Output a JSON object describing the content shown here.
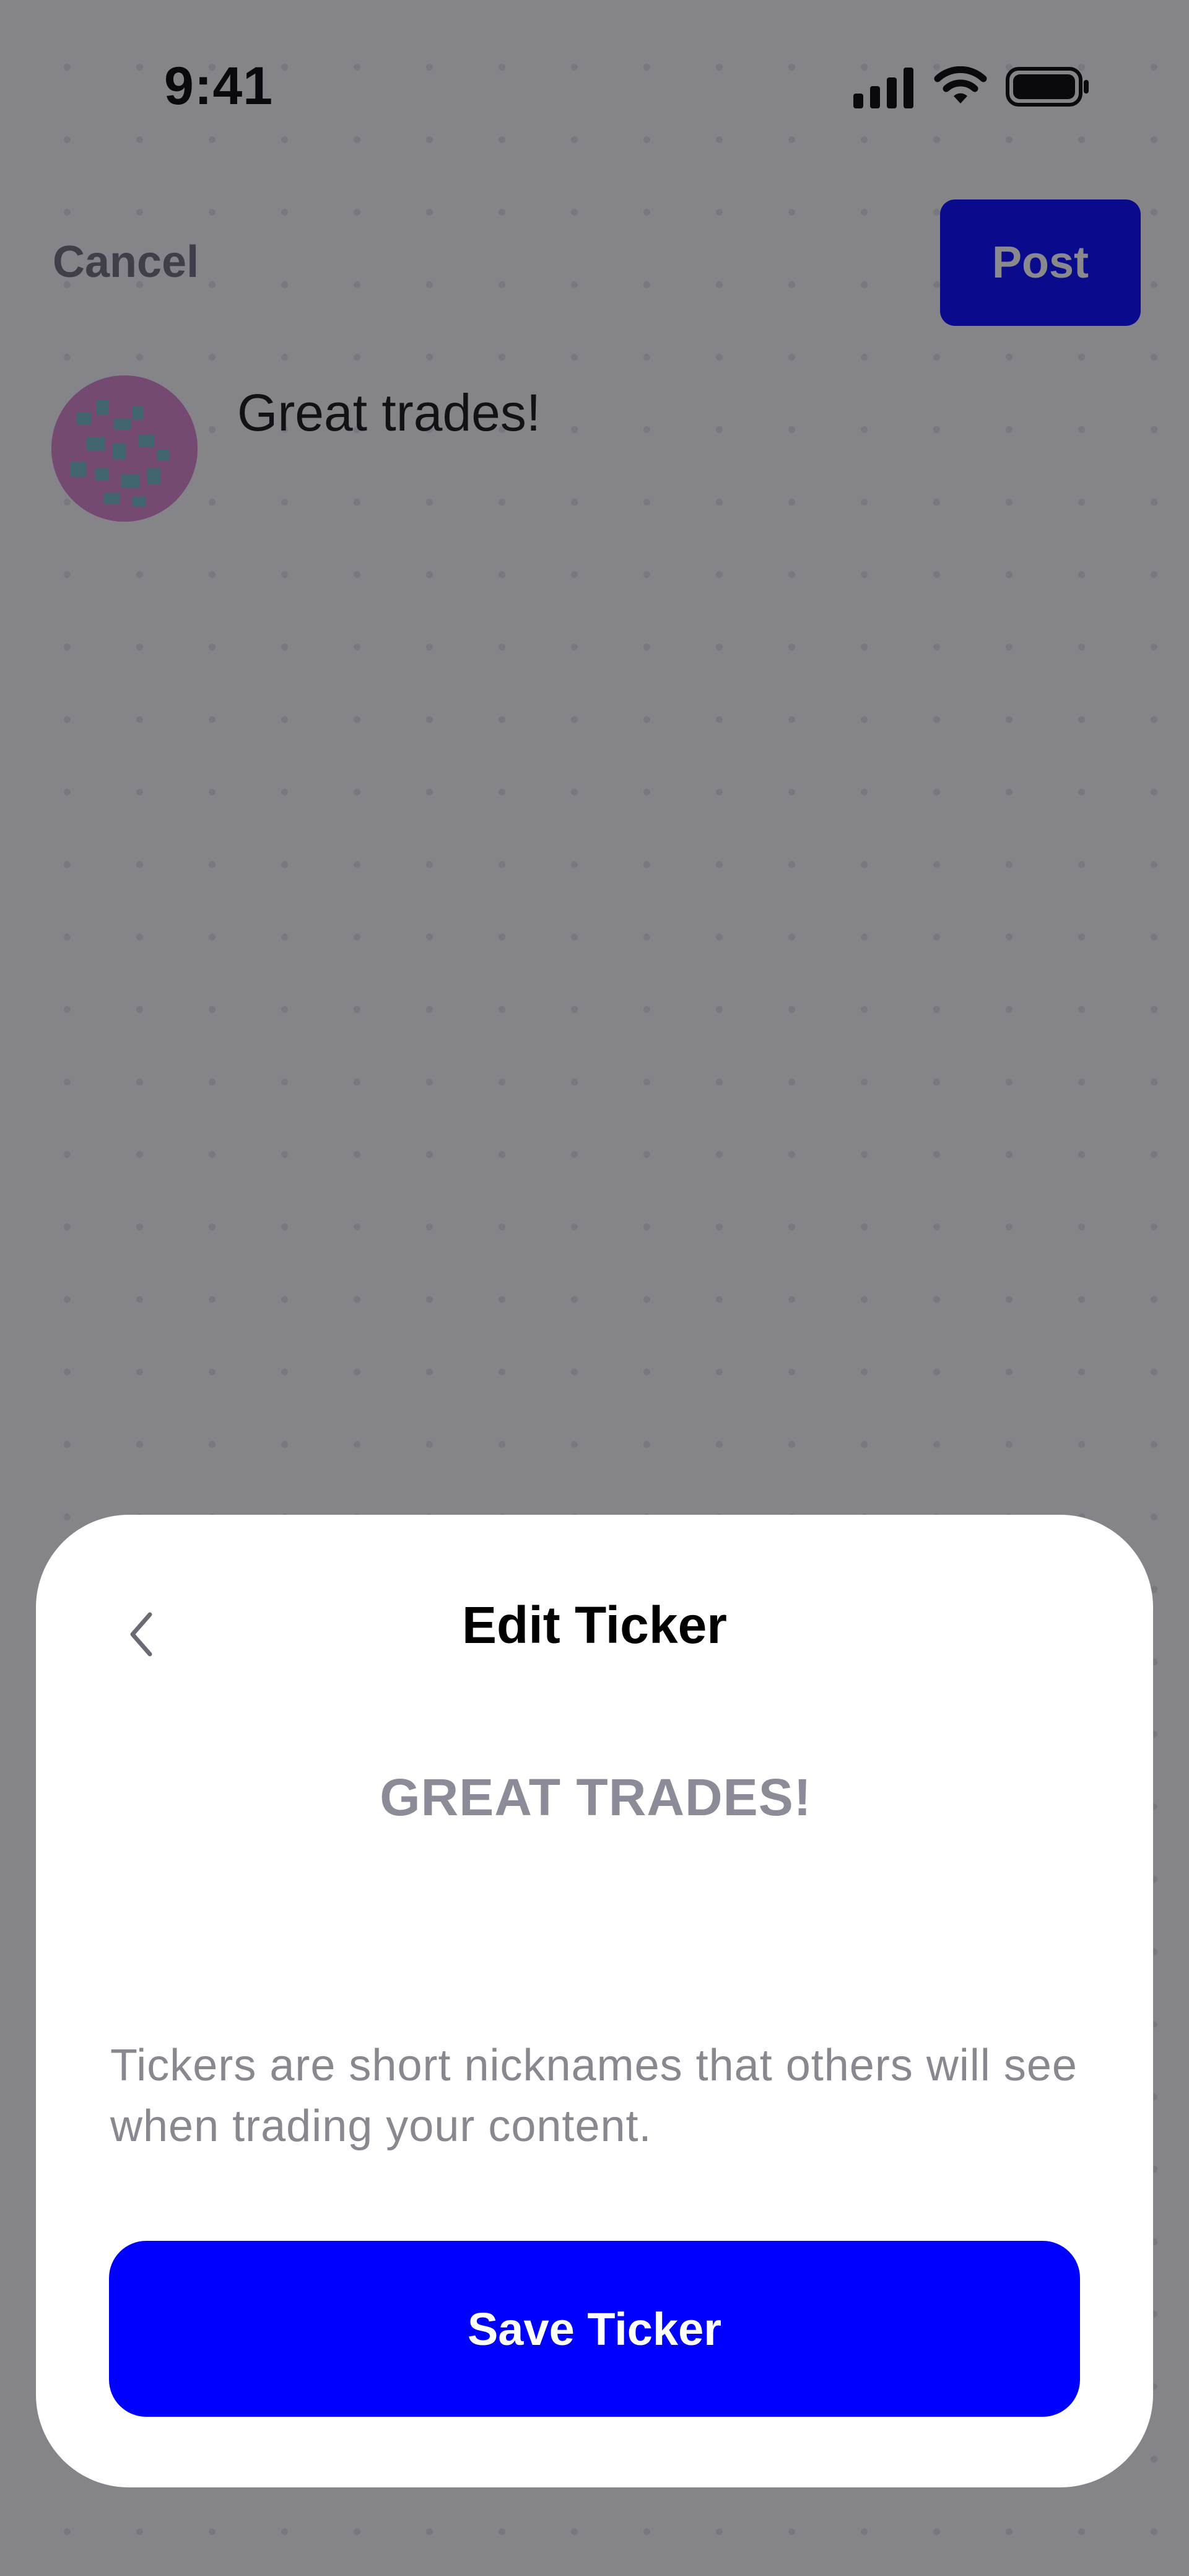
{
  "status_bar": {
    "time": "9:41",
    "icons": [
      "cellular-signal-icon",
      "wifi-icon",
      "battery-icon"
    ]
  },
  "header": {
    "cancel_label": "Cancel",
    "post_label": "Post"
  },
  "composer": {
    "avatar_icon": "avatar",
    "post_text": "Great trades!"
  },
  "sheet": {
    "back_icon": "chevron-left-icon",
    "title": "Edit Ticker",
    "ticker_value": "GREAT TRADES!",
    "help_text": "Tickers are short nicknames that others will see when trading your content.",
    "save_label": "Save Ticker"
  },
  "colors": {
    "accent": "#0000ff",
    "background": "#f4f4f6",
    "overlay": "rgba(20,20,28,0.5)",
    "muted_text": "#888890"
  }
}
